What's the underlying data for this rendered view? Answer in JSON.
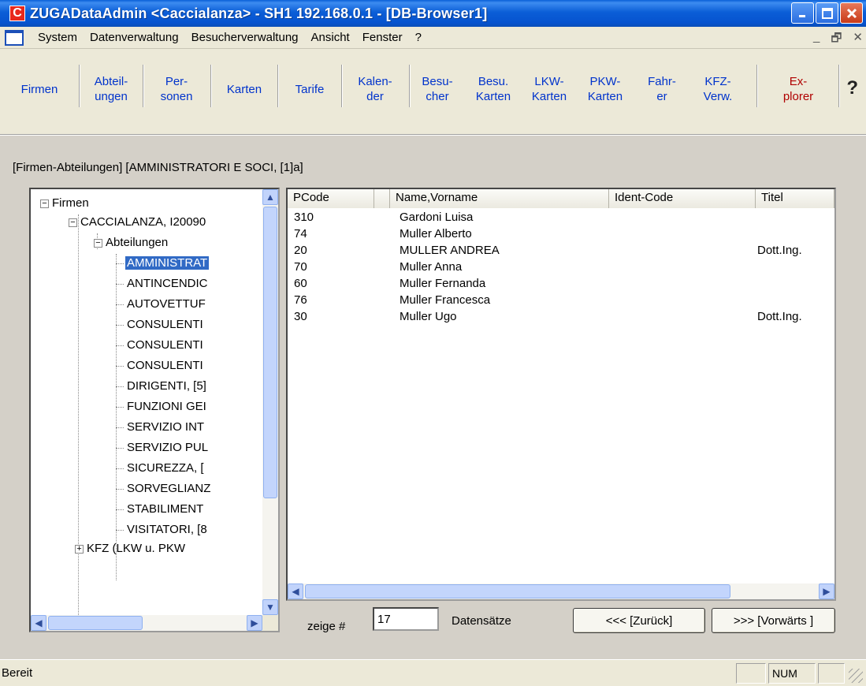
{
  "window": {
    "title": "ZUGADataAdmin <Caccialanza> - SH1 192.168.0.1 - [DB-Browser1]",
    "app_icon_letter": "C"
  },
  "menu": {
    "items": [
      "System",
      "Datenverwaltung",
      "Besucherverwaltung",
      "Ansicht",
      "Fenster",
      "?"
    ]
  },
  "toolbar": {
    "buttons": [
      {
        "label": "Firmen",
        "color": "#0033cc"
      },
      {
        "label": "Abteil-\nungen",
        "color": "#0033cc"
      },
      {
        "label": "Per-\nsonen",
        "color": "#0033cc"
      },
      {
        "label": "Karten",
        "color": "#0033cc"
      },
      {
        "label": "Tarife",
        "color": "#0033cc"
      },
      {
        "label": "Kalen-\nder",
        "color": "#0033cc"
      },
      {
        "label": "Besu-\ncher",
        "color": "#0033cc"
      },
      {
        "label": "Besu.\nKarten",
        "color": "#0033cc"
      },
      {
        "label": "LKW-\nKarten",
        "color": "#0033cc"
      },
      {
        "label": "PKW-\nKarten",
        "color": "#0033cc"
      },
      {
        "label": "Fahr-\ner",
        "color": "#0033cc"
      },
      {
        "label": "KFZ-\nVerw.",
        "color": "#0033cc"
      },
      {
        "label": "Ex-\nplorer",
        "color": "#b00000"
      }
    ],
    "help_icon": "?"
  },
  "breadcrumb": "[Firmen-Abteilungen]  [AMMINISTRATORI E SOCI, [1]a]",
  "tree": {
    "root": "Firmen",
    "company": "CACCIALANZA, I20090",
    "folder": "Abteilungen",
    "departments": [
      "AMMINISTRAT",
      "ANTINCENDIC",
      "AUTOVETTUF",
      "CONSULENTI",
      "CONSULENTI",
      "CONSULENTI",
      "DIRIGENTI, [5]",
      "FUNZIONI GEI",
      "SERVIZIO INT",
      "SERVIZIO PUL",
      "SICUREZZA, [",
      "SORVEGLIANZ",
      "STABILIMENT",
      "VISITATORI, [8"
    ],
    "selected_index": 0,
    "last_node": "KFZ (LKW u. PKW"
  },
  "list": {
    "columns": [
      "PCode",
      "",
      "Name,Vorname",
      "Ident-Code",
      "Titel"
    ],
    "rows": [
      {
        "pcode": "310",
        "name": "Gardoni  Luisa",
        "ident": "",
        "titel": ""
      },
      {
        "pcode": "74",
        "name": "Muller Alberto",
        "ident": "",
        "titel": ""
      },
      {
        "pcode": "20",
        "name": "MULLER ANDREA",
        "ident": "",
        "titel": "Dott.Ing."
      },
      {
        "pcode": "70",
        "name": "Muller Anna",
        "ident": "",
        "titel": ""
      },
      {
        "pcode": "60",
        "name": "Muller Fernanda",
        "ident": "",
        "titel": ""
      },
      {
        "pcode": "76",
        "name": "Muller Francesca",
        "ident": "",
        "titel": ""
      },
      {
        "pcode": "30",
        "name": "Muller Ugo",
        "ident": "",
        "titel": "Dott.Ing."
      }
    ]
  },
  "controls": {
    "show_label": "zeige #",
    "count_value": "17",
    "records_label": "Datensätze",
    "back_button": "<<< [Zurück]",
    "forward_button": ">>> [Vorwärts ]"
  },
  "status": {
    "text": "Bereit",
    "num": "NUM"
  },
  "colors": {
    "title_bar": "#0b5ed7",
    "selection": "#316ac5",
    "toolbar_link": "#0033cc",
    "explorer": "#b00000"
  }
}
